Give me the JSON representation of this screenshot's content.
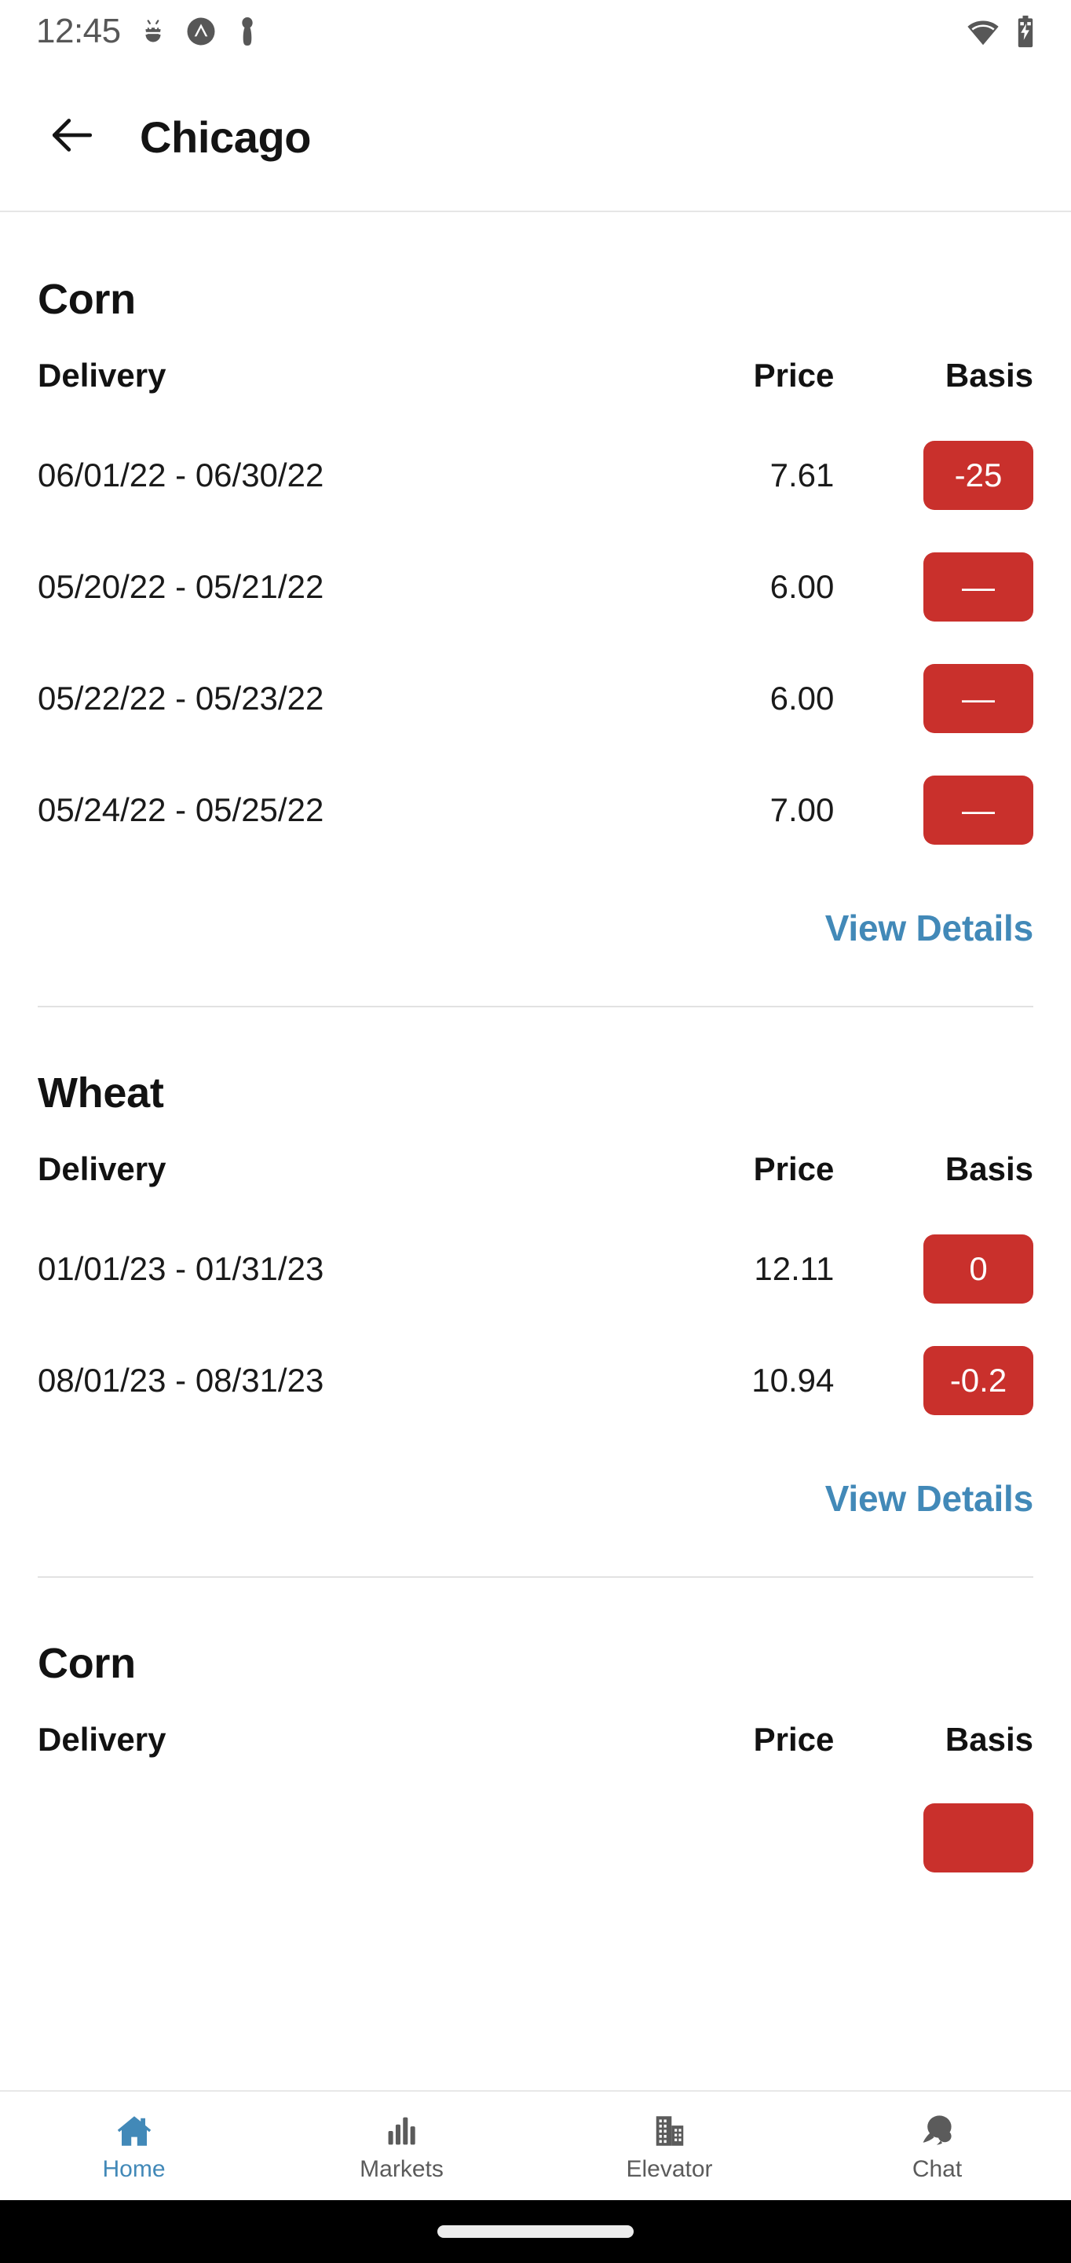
{
  "status_bar": {
    "time": "12:45",
    "icons_left": [
      "android-debug-icon",
      "circle-chevron-up-icon",
      "location-pin-icon"
    ],
    "icons_right": [
      "wifi-icon",
      "battery-charging-icon"
    ]
  },
  "app_bar": {
    "back_label": "back-arrow-icon",
    "title": "Chicago"
  },
  "colors": {
    "basis_badge": "#c9302c",
    "link": "#4289b8",
    "accent": "#4289b8",
    "text": "#121212",
    "divider": "#e2e2e2"
  },
  "table_headers": {
    "delivery": "Delivery",
    "price": "Price",
    "basis": "Basis"
  },
  "view_details_label": "View Details",
  "sections": [
    {
      "commodity": "Corn",
      "rows": [
        {
          "delivery": "06/01/22 - 06/30/22",
          "price": "7.61",
          "basis": "-25"
        },
        {
          "delivery": "05/20/22 - 05/21/22",
          "price": "6.00",
          "basis": "—"
        },
        {
          "delivery": "05/22/22 - 05/23/22",
          "price": "6.00",
          "basis": "—"
        },
        {
          "delivery": "05/24/22 - 05/25/22",
          "price": "7.00",
          "basis": "—"
        }
      ]
    },
    {
      "commodity": "Wheat",
      "rows": [
        {
          "delivery": "01/01/23 - 01/31/23",
          "price": "12.11",
          "basis": "0"
        },
        {
          "delivery": "08/01/23 - 08/31/23",
          "price": "10.94",
          "basis": "-0.2"
        }
      ]
    },
    {
      "commodity": "Corn",
      "rows": []
    }
  ],
  "bottom_nav": {
    "items": [
      {
        "label": "Home",
        "icon": "home-icon",
        "active": true
      },
      {
        "label": "Markets",
        "icon": "bar-chart-icon",
        "active": false
      },
      {
        "label": "Elevator",
        "icon": "buildings-icon",
        "active": false
      },
      {
        "label": "Chat",
        "icon": "chat-bubble-icon",
        "active": false
      }
    ]
  }
}
